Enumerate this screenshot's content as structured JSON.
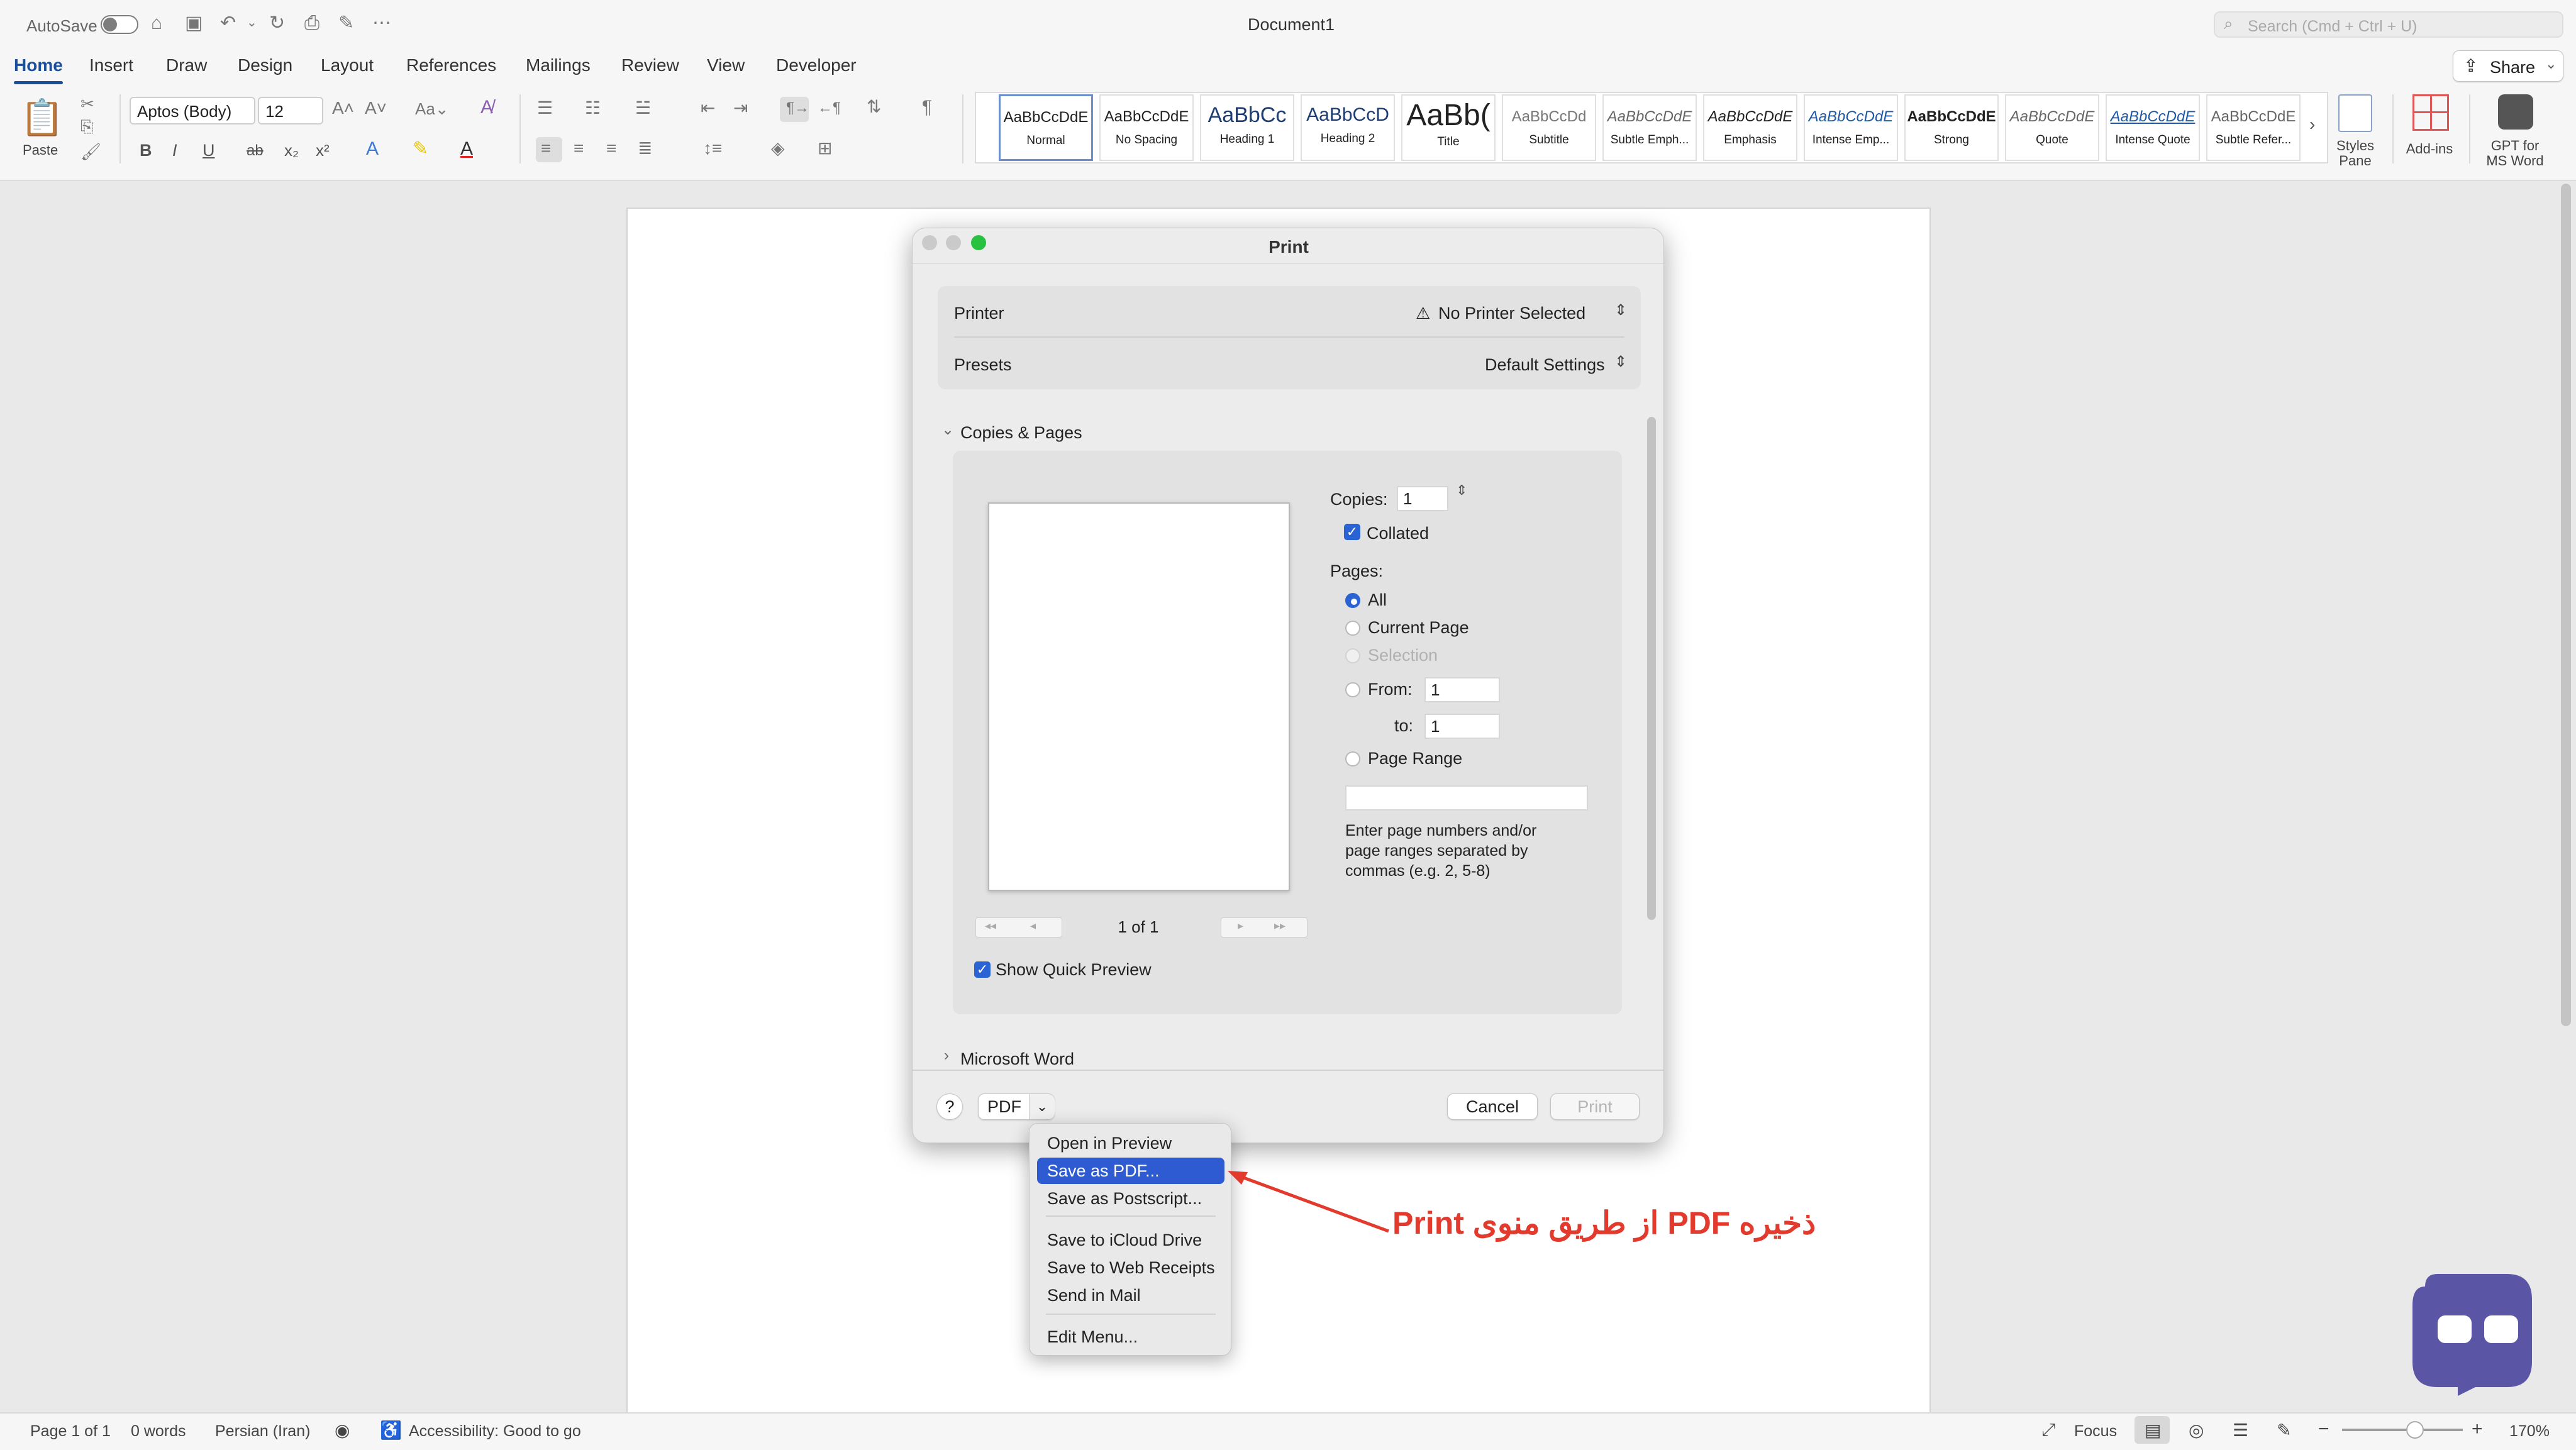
{
  "titlebar": {
    "autosave_label": "AutoSave",
    "document_title": "Document1",
    "search_placeholder": "Search (Cmd + Ctrl + U)",
    "share_label": "Share"
  },
  "ribbon_tabs": [
    "Home",
    "Insert",
    "Draw",
    "Design",
    "Layout",
    "References",
    "Mailings",
    "Review",
    "View",
    "Developer"
  ],
  "ribbon": {
    "paste_label": "Paste",
    "font_name": "Aptos (Body)",
    "font_size": "12",
    "font_buttons": [
      "B",
      "I",
      "U",
      "ab",
      "x₂",
      "x²"
    ],
    "styles": [
      {
        "preview": "AaBbCcDdE",
        "name": "Normal"
      },
      {
        "preview": "AaBbCcDdE",
        "name": "No Spacing"
      },
      {
        "preview": "AaBbCc",
        "name": "Heading 1"
      },
      {
        "preview": "AaBbCcD",
        "name": "Heading 2"
      },
      {
        "preview": "AaBb(",
        "name": "Title"
      },
      {
        "preview": "AaBbCcDd",
        "name": "Subtitle"
      },
      {
        "preview": "AaBbCcDdE",
        "name": "Subtle Emph..."
      },
      {
        "preview": "AaBbCcDdE",
        "name": "Emphasis"
      },
      {
        "preview": "AaBbCcDdE",
        "name": "Intense Emp..."
      },
      {
        "preview": "AaBbCcDdE",
        "name": "Strong"
      },
      {
        "preview": "AaBbCcDdE",
        "name": "Quote"
      },
      {
        "preview": "AaBbCcDdE",
        "name": "Intense Quote"
      },
      {
        "preview": "AaBbCcDdE",
        "name": "Subtle Refer..."
      }
    ],
    "styles_pane_label": "Styles Pane",
    "addins_label": "Add-ins",
    "gpt_label": "GPT for MS Word"
  },
  "print_dialog": {
    "title": "Print",
    "printer_label": "Printer",
    "printer_value": "No Printer Selected",
    "presets_label": "Presets",
    "presets_value": "Default Settings",
    "copies_pages_header": "Copies & Pages",
    "copies_label": "Copies:",
    "copies_value": "1",
    "collated_label": "Collated",
    "pages_label": "Pages:",
    "opt_all": "All",
    "opt_current": "Current Page",
    "opt_selection": "Selection",
    "opt_from": "From:",
    "from_value": "1",
    "to_label": "to:",
    "to_value": "1",
    "opt_page_range": "Page Range",
    "page_range_help": "Enter page numbers and/or page ranges separated by commas (e.g. 2, 5-8)",
    "page_indicator": "1 of 1",
    "show_quick_preview": "Show Quick Preview",
    "microsoft_word_section": "Microsoft Word",
    "help_label": "?",
    "pdf_label": "PDF",
    "cancel_label": "Cancel",
    "print_label": "Print"
  },
  "pdf_menu": {
    "items": [
      "Open in Preview",
      "Save as PDF...",
      "Save as Postscript...",
      "Save to iCloud Drive",
      "Save to Web Receipts",
      "Send in Mail",
      "Edit Menu..."
    ],
    "highlighted": "Save as PDF..."
  },
  "annotation": {
    "text": "ذخیره PDF از طریق منوی Print",
    "color": "#e23b2e"
  },
  "statusbar": {
    "page": "Page 1 of 1",
    "words": "0 words",
    "language": "Persian (Iran)",
    "accessibility": "Accessibility: Good to go",
    "focus_label": "Focus",
    "zoom": "170%"
  },
  "colors": {
    "accent": "#2a63d4",
    "menu_highlight": "#2f5bd2",
    "tab_active": "#1b4f9c",
    "traffic_close": "#c9c9c9",
    "traffic_max": "#29c140",
    "logo": "#5b55a6"
  }
}
